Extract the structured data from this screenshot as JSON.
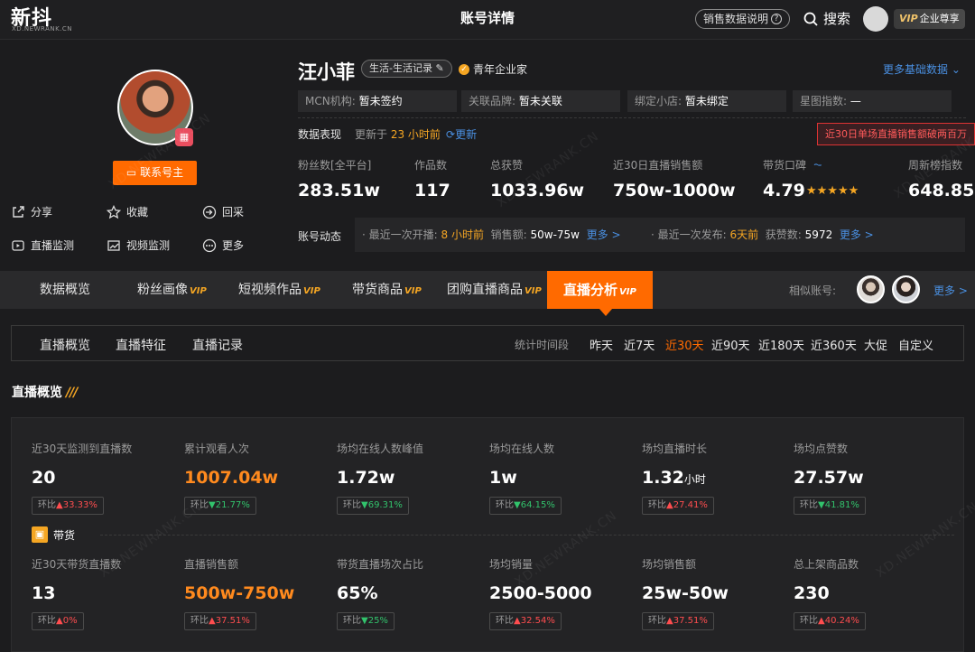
{
  "topbar": {
    "logo": "新抖",
    "logo_sub": "XD.NEWRANK.CN",
    "title": "账号详情",
    "sales_explain": "销售数据说明",
    "search": "搜索",
    "vip_label": "VIP",
    "vip_text": "企业尊享"
  },
  "profile": {
    "contact_button": "联系号主",
    "actions": {
      "share": "分享",
      "favorite": "收藏",
      "collect": "回采",
      "live_monitor": "直播监测",
      "video_monitor": "视频监测",
      "more": "更多"
    },
    "name": "汪小菲",
    "tag": "生活-生活记录",
    "verification": "青年企业家",
    "more_basic": "更多基础数据",
    "info": {
      "mcn_label": "MCN机构:",
      "mcn_value": "暂未签约",
      "brand_label": "关联品牌:",
      "brand_value": "暂未关联",
      "shop_label": "绑定小店:",
      "shop_value": "暂未绑定",
      "star_label": "星图指数:",
      "star_value": "—"
    },
    "performance": {
      "label": "数据表现",
      "updated_prefix": "更新于",
      "updated_value": "23 小时前",
      "refresh": "更新",
      "alert": "近30日单场直播销售额破两百万"
    },
    "stats": [
      {
        "label": "粉丝数[全平台]",
        "value": "283.51w"
      },
      {
        "label": "作品数",
        "value": "117"
      },
      {
        "label": "总获赞",
        "value": "1033.96w"
      },
      {
        "label": "近30日直播销售额",
        "value": "750w-1000w"
      },
      {
        "label": "带货口碑",
        "value": "4.79"
      },
      {
        "label": "周新榜指数",
        "value": "648.85"
      }
    ],
    "rating_stars": "★★★★★",
    "dynamics": {
      "label": "账号动态",
      "live_prefix": "· 最近一次开播:",
      "live_time": "8 小时前",
      "sales_label": "销售额:",
      "sales_value": "50w-75w",
      "more1": "更多 >",
      "post_prefix": "· 最近一次发布:",
      "post_time": "6天前",
      "likes_label": "获赞数:",
      "likes_value": "5972",
      "more2": "更多 >"
    }
  },
  "tabs": {
    "items": [
      {
        "label": "数据概览",
        "vip": ""
      },
      {
        "label": "粉丝画像",
        "vip": "VIP"
      },
      {
        "label": "短视频作品",
        "vip": "VIP"
      },
      {
        "label": "带货商品",
        "vip": "VIP"
      },
      {
        "label": "团购直播商品",
        "vip": "VIP"
      },
      {
        "label": "直播分析",
        "vip": "VIP"
      }
    ],
    "similar_label": "相似账号:",
    "similar_more": "更多 >"
  },
  "subtabs": {
    "items": [
      "直播概览",
      "直播特征",
      "直播记录"
    ],
    "period_label": "统计时间段",
    "periods": [
      "昨天",
      "近7天",
      "近30天",
      "近90天",
      "近180天",
      "近360天",
      "大促",
      "自定义"
    ],
    "active_period": "近30天"
  },
  "overview": {
    "title": "直播概览",
    "title_deco": "///",
    "row1": [
      {
        "label": "近30天监测到直播数",
        "value": "20",
        "change_label": "环比",
        "change": "33.33%",
        "dir": "up"
      },
      {
        "label": "累计观看人次",
        "value": "1007.04w",
        "change_label": "环比",
        "change": "21.77%",
        "dir": "down"
      },
      {
        "label": "场均在线人数峰值",
        "value": "1.72w",
        "change_label": "环比",
        "change": "69.31%",
        "dir": "down"
      },
      {
        "label": "场均在线人数",
        "value": "1w",
        "change_label": "环比",
        "change": "64.15%",
        "dir": "down"
      },
      {
        "label": "场均直播时长",
        "value": "1.32",
        "unit": "小时",
        "change_label": "环比",
        "change": "27.41%",
        "dir": "up"
      },
      {
        "label": "场均点赞数",
        "value": "27.57w",
        "change_label": "环比",
        "change": "41.81%",
        "dir": "down"
      }
    ],
    "goods_badge": "带货",
    "row2": [
      {
        "label": "近30天带货直播数",
        "value": "13",
        "change_label": "环比",
        "change": "0%",
        "dir": "up"
      },
      {
        "label": "直播销售额",
        "value": "500w-750w",
        "change_label": "环比",
        "change": "37.51%",
        "dir": "up"
      },
      {
        "label": "带货直播场次占比",
        "value": "65%",
        "change_label": "环比",
        "change": "25%",
        "dir": "down"
      },
      {
        "label": "场均销量",
        "value": "2500-5000",
        "change_label": "环比",
        "change": "32.54%",
        "dir": "up"
      },
      {
        "label": "场均销售额",
        "value": "25w-50w",
        "change_label": "环比",
        "change": "37.51%",
        "dir": "up"
      },
      {
        "label": "总上架商品数",
        "value": "230",
        "change_label": "环比",
        "change": "40.24%",
        "dir": "up"
      }
    ]
  },
  "watermark": "XD.NEWRANK.CN",
  "colors": {
    "accent": "#ff6a00",
    "link": "#4a90e2",
    "up": "#ff4d4f",
    "down": "#32c36c",
    "gold": "#f5a623"
  }
}
